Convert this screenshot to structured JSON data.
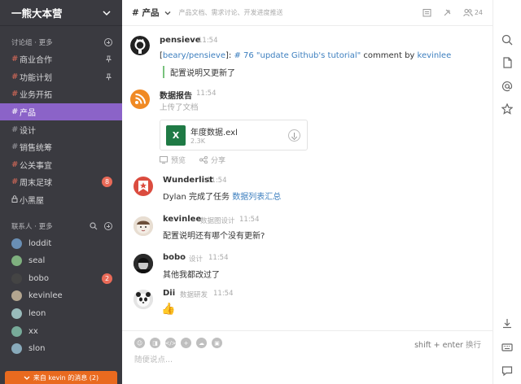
{
  "team": {
    "name": "一熊大本营"
  },
  "channels_section": {
    "title": "讨论组 · 更多"
  },
  "channels": [
    {
      "name": "商业合作",
      "pinned": true,
      "badge": "",
      "hash": "red"
    },
    {
      "name": "功能计划",
      "pinned": true,
      "badge": "",
      "hash": "red"
    },
    {
      "name": "业务开拓",
      "pinned": false,
      "badge": "",
      "hash": "red"
    },
    {
      "name": "产品",
      "pinned": false,
      "badge": "",
      "hash": "normal",
      "active": true
    },
    {
      "name": "设计",
      "pinned": false,
      "badge": "",
      "hash": "normal"
    },
    {
      "name": "销售统筹",
      "pinned": false,
      "badge": "",
      "hash": "normal"
    },
    {
      "name": "公关事宜",
      "pinned": false,
      "badge": "",
      "hash": "red"
    },
    {
      "name": "周末足球",
      "pinned": false,
      "badge": "8",
      "hash": "red"
    },
    {
      "name": "小黑屋",
      "pinned": false,
      "badge": "",
      "hash": "lock"
    }
  ],
  "contacts_section": {
    "title": "联系人 · 更多"
  },
  "contacts": [
    {
      "name": "loddit",
      "badge": ""
    },
    {
      "name": "seal",
      "badge": ""
    },
    {
      "name": "bobo",
      "badge": "2"
    },
    {
      "name": "kevinlee",
      "badge": ""
    },
    {
      "name": "leon",
      "badge": ""
    },
    {
      "name": "xx",
      "badge": ""
    },
    {
      "name": "slon",
      "badge": ""
    }
  ],
  "unread_notice": "来自 kevin 的消息 (2)",
  "header": {
    "channel": "# 产品",
    "description": "产品文档、需求讨论、开发进度推送",
    "member_count": "24"
  },
  "messages": {
    "m1": {
      "author": "pensieve",
      "time": "11:54",
      "repo": "beary/pensieve",
      "issue": "# 76 \"update Github's tutorial\"",
      "action": " comment by ",
      "user": "kevinlee",
      "quote": "配置说明又更新了"
    },
    "m2": {
      "author": "数据报告",
      "time": "11:54",
      "text": "上传了文档",
      "file_name": "年度数据.exl",
      "file_size": "2.3K",
      "preview": "预览",
      "share": "分享"
    },
    "m3": {
      "author": "Wunderlist",
      "time": "11:54",
      "text_pre": "Dylan 完成了任务 ",
      "task": "数据列表汇总"
    },
    "m4": {
      "author": "kevinlee",
      "role": "数据图设计",
      "time": "11:54",
      "text": "配置说明还有哪个没有更新?"
    },
    "m5": {
      "author": "bobo",
      "role": "设计",
      "time": "11:54",
      "text": "其他我都改过了"
    },
    "m6": {
      "author": "Dii",
      "role": "数据研发",
      "time": "11:54",
      "text": "👍"
    }
  },
  "composer": {
    "hint_key": "shift + enter",
    "hint_text": " 换行",
    "placeholder": "随便说点..."
  }
}
